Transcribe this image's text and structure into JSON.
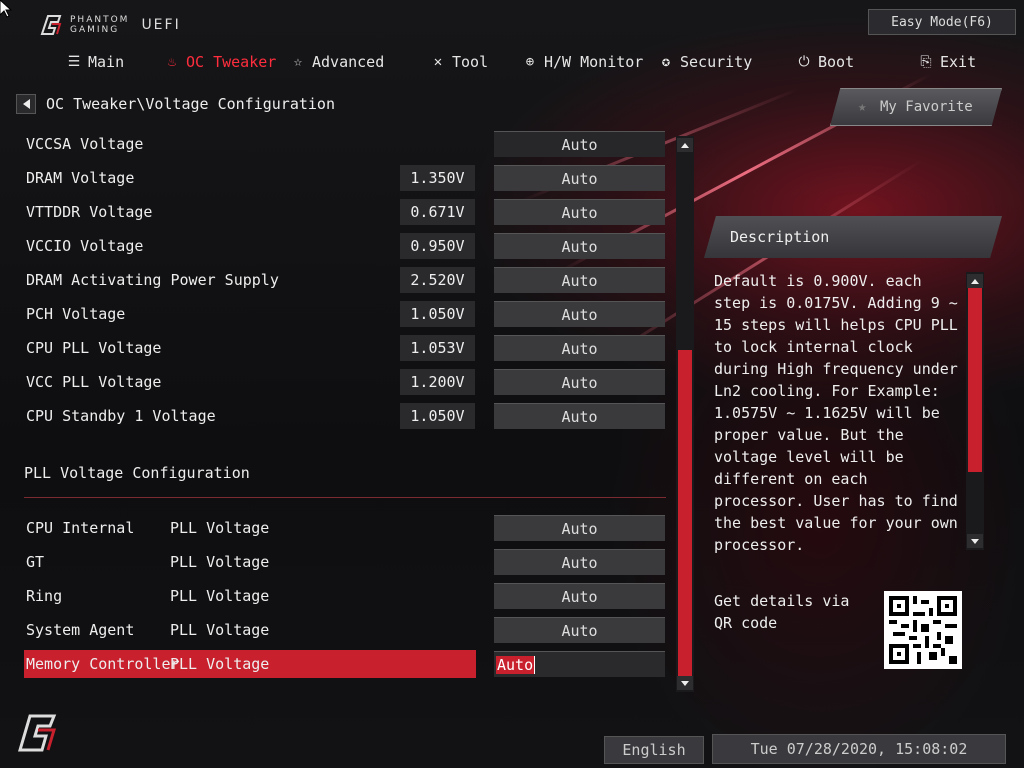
{
  "header": {
    "brand_line1": "PHANTOM",
    "brand_line2": "GAMING",
    "uefi": "UEFI",
    "easy_mode": "Easy Mode(F6)"
  },
  "nav": {
    "items": [
      {
        "label": "Main",
        "icon": "list-icon"
      },
      {
        "label": "OC Tweaker",
        "icon": "flame-icon"
      },
      {
        "label": "Advanced",
        "icon": "star-icon"
      },
      {
        "label": "Tool",
        "icon": "tools-icon"
      },
      {
        "label": "H/W Monitor",
        "icon": "crosshair-icon"
      },
      {
        "label": "Security",
        "icon": "shield-icon"
      },
      {
        "label": "Boot",
        "icon": "power-icon"
      },
      {
        "label": "Exit",
        "icon": "exit-icon"
      }
    ],
    "active": "OC Tweaker"
  },
  "breadcrumb": "OC Tweaker\\Voltage Configuration",
  "settings": [
    {
      "label": "VCCSA Voltage",
      "value": "",
      "setting": "Auto"
    },
    {
      "label": "DRAM Voltage",
      "value": "1.350V",
      "setting": "Auto"
    },
    {
      "label": "VTTDDR Voltage",
      "value": "0.671V",
      "setting": "Auto"
    },
    {
      "label": "VCCIO Voltage",
      "value": "0.950V",
      "setting": "Auto"
    },
    {
      "label": "DRAM Activating Power Supply",
      "value": "2.520V",
      "setting": "Auto"
    },
    {
      "label": "PCH Voltage",
      "value": "1.050V",
      "setting": "Auto"
    },
    {
      "label": "CPU PLL Voltage",
      "value": "1.053V",
      "setting": "Auto"
    },
    {
      "label": "VCC PLL Voltage",
      "value": "1.200V",
      "setting": "Auto"
    },
    {
      "label": "CPU Standby 1 Voltage",
      "value": "1.050V",
      "setting": "Auto"
    }
  ],
  "pll_section": {
    "title": "PLL Voltage Configuration",
    "items": [
      {
        "label": "CPU Internal",
        "sub": "PLL Voltage",
        "setting": "Auto"
      },
      {
        "label": "GT",
        "sub": "PLL Voltage",
        "setting": "Auto"
      },
      {
        "label": "Ring",
        "sub": "PLL Voltage",
        "setting": "Auto"
      },
      {
        "label": "System Agent",
        "sub": "PLL Voltage",
        "setting": "Auto"
      },
      {
        "label": "Memory Controller",
        "sub": "PLL Voltage",
        "setting": "Auto"
      }
    ],
    "selected_index": 4
  },
  "my_favorite": "My Favorite",
  "description": {
    "title": "Description",
    "text": "Default is 0.900V. each step is 0.0175V. Adding 9 ~ 15 steps will helps CPU PLL to lock internal clock during High frequency under Ln2 cooling. For Example: 1.0575V ~ 1.1625V will be proper value. But the voltage level will be different on each processor. User has to find the best value for your own processor."
  },
  "qr_text": "Get details via QR code",
  "footer": {
    "language": "English",
    "datetime": "Tue 07/28/2020, 15:08:02"
  },
  "colors": {
    "accent": "#c8202d",
    "active_nav": "#ff2d3d"
  }
}
